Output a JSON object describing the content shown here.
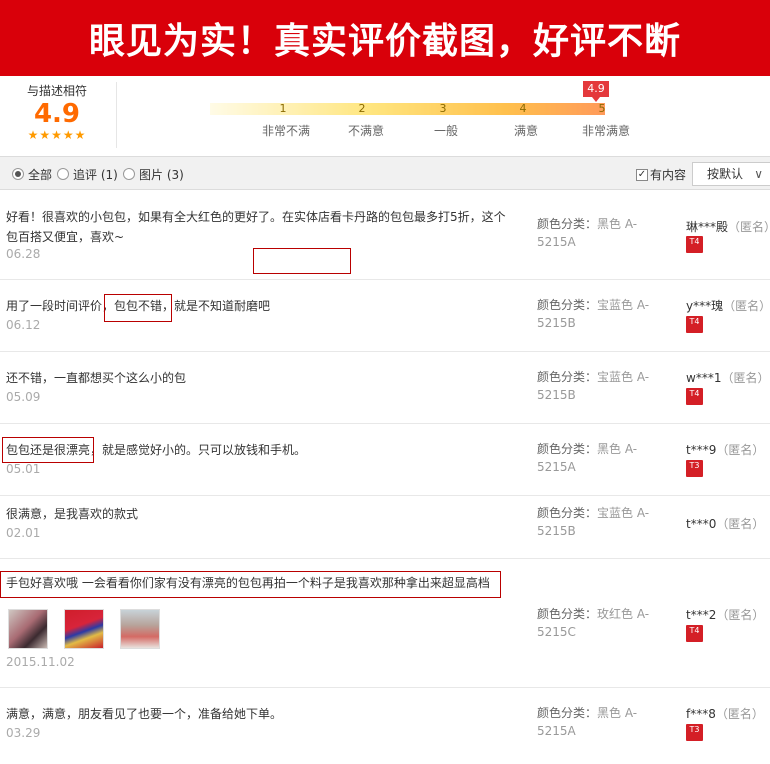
{
  "banner": {
    "title": "眼见为实！真实评价截图，好评不断"
  },
  "summary": {
    "desc_label": "与描述相符",
    "score": "4.9",
    "stars": "★★★★★",
    "marker": "4.9",
    "scale_numbers": [
      "1",
      "2",
      "3",
      "4",
      "5"
    ],
    "scale_labels": [
      "非常不满",
      "不满意",
      "一般",
      "满意",
      "非常满意"
    ]
  },
  "filters": {
    "all": "全部",
    "followup": "追评 (1)",
    "images": "图片 (3)",
    "has_content": "有内容",
    "sort": "按默认"
  },
  "reviews": [
    {
      "text": "好看！很喜欢的小包包，如果有全大红色的更好了。在实体店看卡丹路的包包最多打5折，这个包百搭又便宜，喜欢~",
      "date": "06.28",
      "sku_label": "颜色分类：",
      "sku": "黑色 A-5215A",
      "user": "琳***殿",
      "anon": "（匿名）",
      "badge": "T4"
    },
    {
      "text": "用了一段时间评价，包包不错，就是不知道耐磨吧",
      "date": "06.12",
      "sku_label": "颜色分类：",
      "sku": "宝蓝色 A-5215B",
      "user": "y***瑰",
      "anon": "（匿名）",
      "badge": "T4"
    },
    {
      "text": "还不错，一直都想买个这么小的包",
      "date": "05.09",
      "sku_label": "颜色分类：",
      "sku": "宝蓝色 A-5215B",
      "user": "w***1",
      "anon": "（匿名）",
      "badge": "T4"
    },
    {
      "text": "包包还是很漂亮，就是感觉好小的。只可以放钱和手机。",
      "date": "05.01",
      "sku_label": "颜色分类：",
      "sku": "黑色 A-5215A",
      "user": "t***9",
      "anon": "（匿名）",
      "badge": "T3"
    },
    {
      "text": "很满意，是我喜欢的款式",
      "date": "02.01",
      "sku_label": "颜色分类：",
      "sku": "宝蓝色 A-5215B",
      "user": "t***0",
      "anon": "（匿名）",
      "badge": ""
    },
    {
      "text": "手包好喜欢哦 一会看看你们家有没有漂亮的包包再拍一个料子是我喜欢那种拿出来超显高档",
      "date": "2015.11.02",
      "sku_label": "颜色分类：",
      "sku": "玫红色 A-5215C",
      "user": "t***2",
      "anon": "（匿名）",
      "badge": "T4"
    },
    {
      "text": "满意，满意，朋友看见了也要一个，准备给她下单。",
      "date": "03.29",
      "sku_label": "颜色分类：",
      "sku": "黑色 A-5215A",
      "user": "f***8",
      "anon": "（匿名）",
      "badge": "T3"
    }
  ],
  "colors": {
    "banner": "#d9000a",
    "accent": "#ff6a00",
    "marker": "#e4393c",
    "highlight": "#b90000"
  }
}
